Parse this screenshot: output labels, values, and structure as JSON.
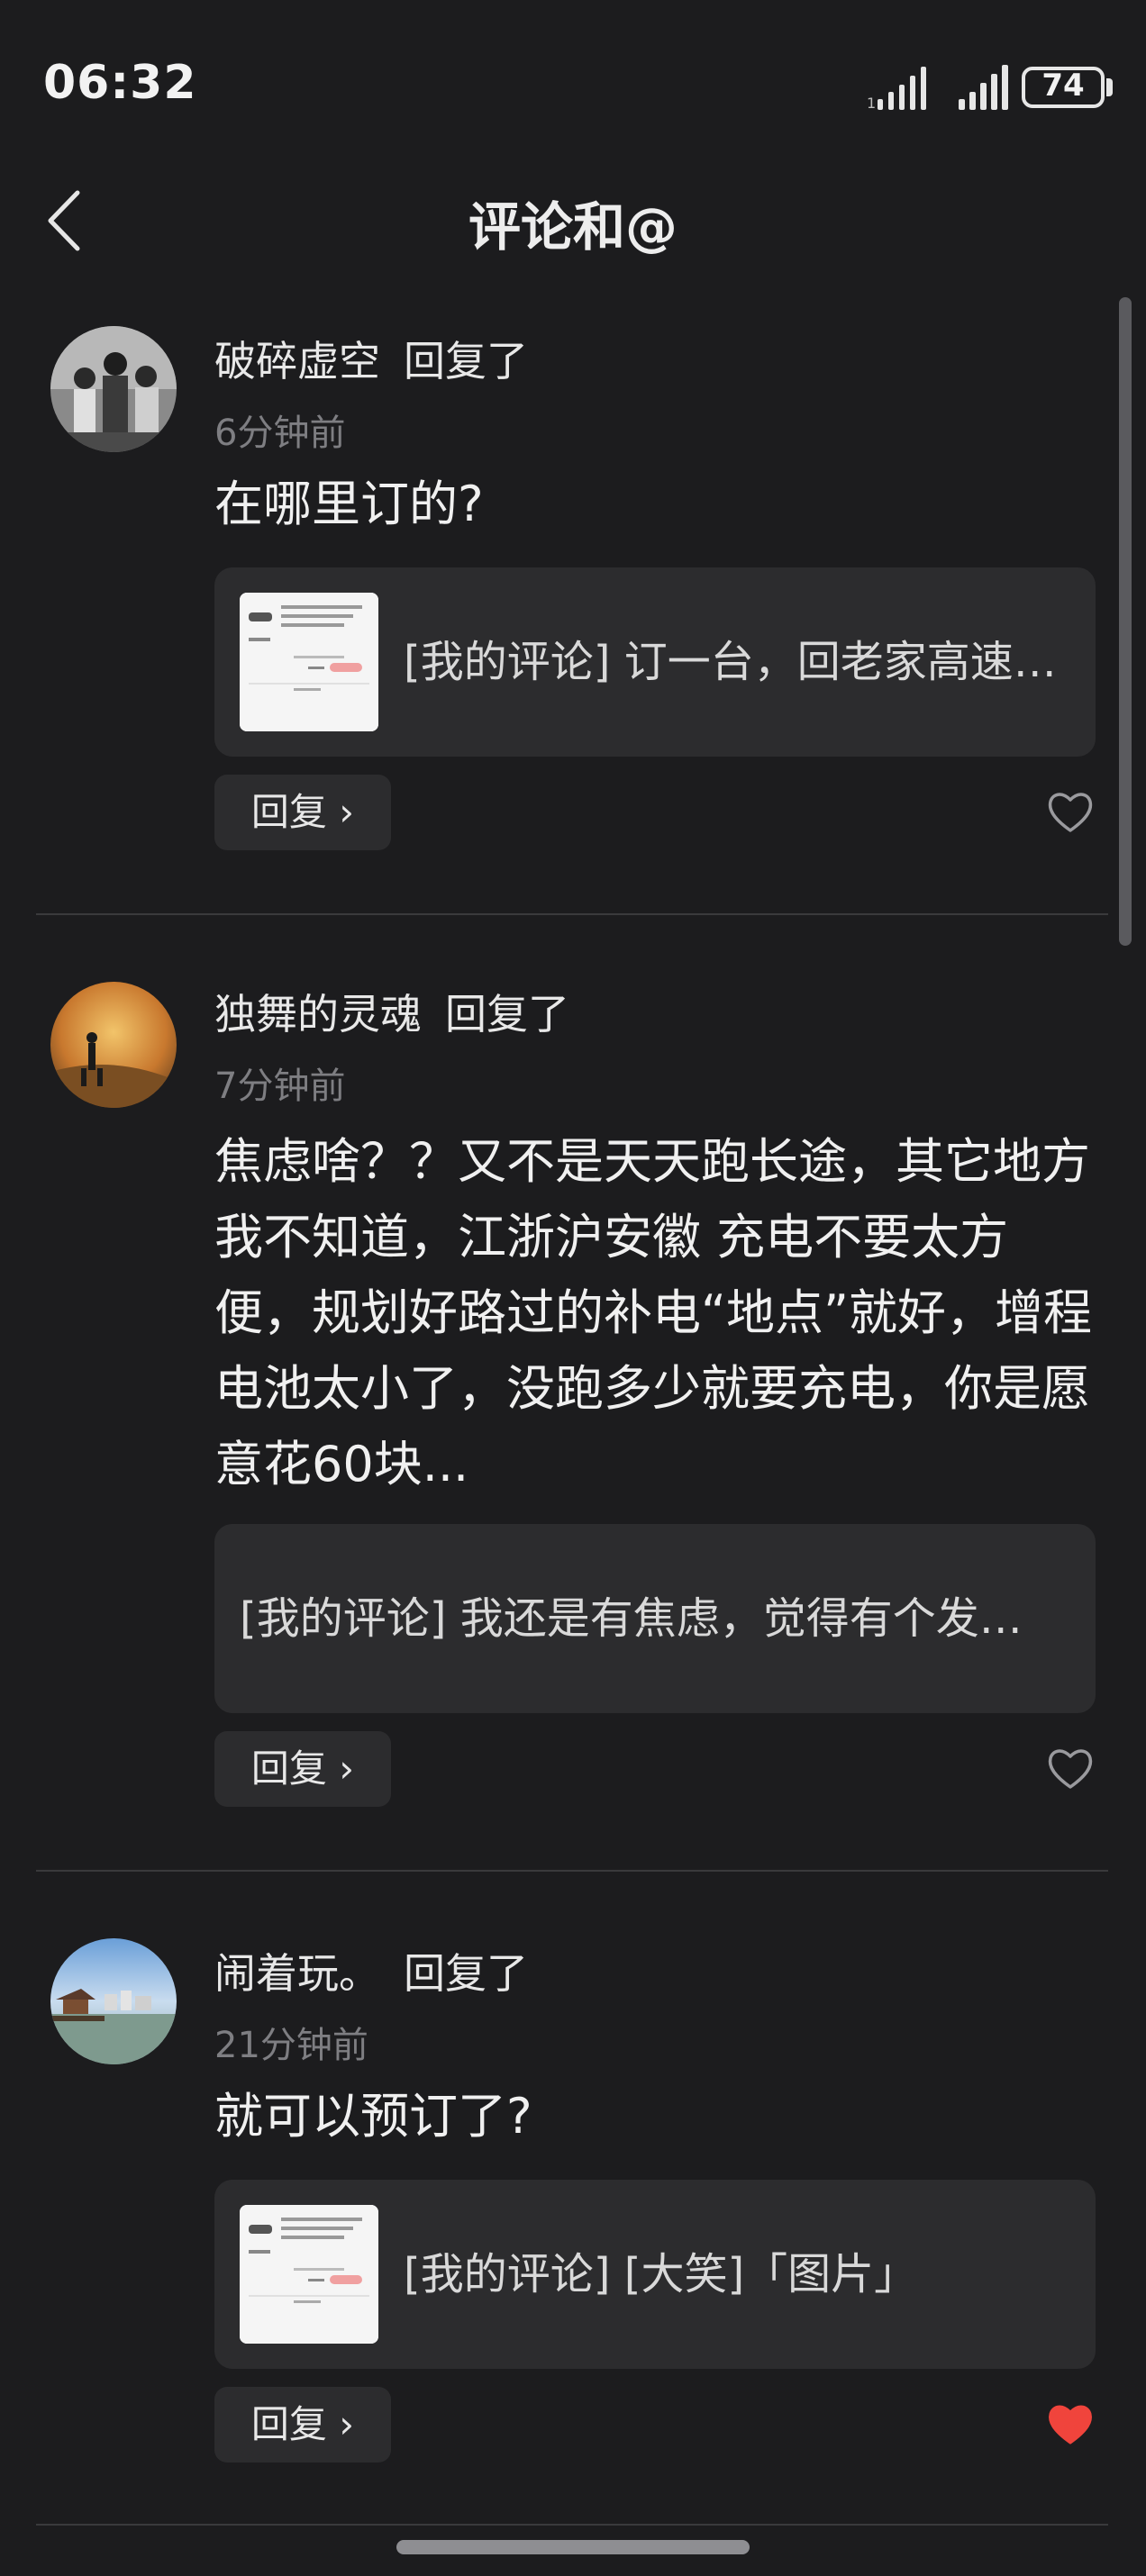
{
  "status_bar": {
    "time": "06:32",
    "battery": "74",
    "icons": [
      "signal-1-icon",
      "signal-2-icon",
      "battery-icon"
    ]
  },
  "header": {
    "title": "评论和@",
    "back_icon": "chevron-left-icon"
  },
  "comments": [
    {
      "username": "破碎虚空",
      "action": "回复了",
      "time_ago": "6分钟前",
      "text": "在哪里订的?",
      "quote": "[我的评论] 订一台，回老家高速…",
      "has_thumbnail": true,
      "reply_label": "回复 ›",
      "liked": false
    },
    {
      "username": "独舞的灵魂",
      "action": "回复了",
      "time_ago": "7分钟前",
      "text": "焦虑啥？？又不是天天跑长途，其它地方我不知道，江浙沪安徽 充电不要太方便，规划好路过的补电“地点”就好，增程电池太小了，没跑多少就要充电，你是愿意花60块...",
      "quote": "[我的评论] 我还是有焦虑，觉得有个发…",
      "has_thumbnail": false,
      "reply_label": "回复 ›",
      "liked": false
    },
    {
      "username": "闹着玩。",
      "action": "回复了",
      "time_ago": "21分钟前",
      "text": "就可以预订了?",
      "quote": "[我的评论] [大笑]「图片」",
      "has_thumbnail": true,
      "reply_label": "回复 ›",
      "liked": true
    }
  ],
  "colors": {
    "background": "#1c1c1e",
    "card": "#2c2c2e",
    "muted_text": "#7e7e82",
    "like_active": "#f0443c"
  }
}
